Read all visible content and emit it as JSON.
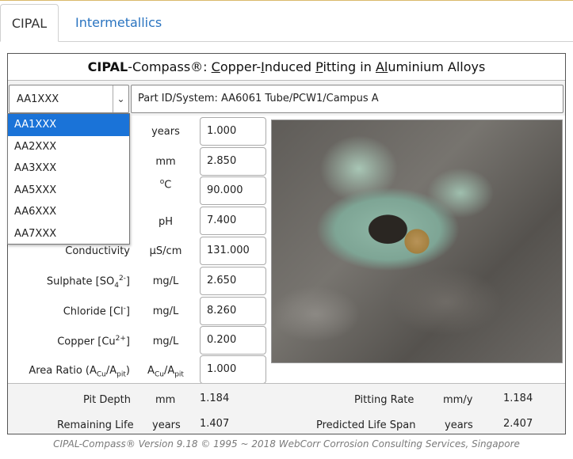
{
  "tabs": [
    {
      "label": "CIPAL",
      "active": true
    },
    {
      "label": "Intermetallics",
      "active": false
    }
  ],
  "title": {
    "brand": "CIPAL",
    "suffix": "-Compass®: ",
    "c1": "C",
    "r1": "opper-",
    "i1": "I",
    "r2": "nduced ",
    "p1": "P",
    "r3": "itting in ",
    "al": "Al",
    "r4": "uminium Alloys"
  },
  "alloy_select": {
    "value": "AA1XXX",
    "arrow": "⌄"
  },
  "part_id": "Part ID/System: AA6061 Tube/PCW1/Campus A",
  "dropdown_options": [
    "AA1XXX",
    "AA2XXX",
    "AA3XXX",
    "AA5XXX",
    "AA6XXX",
    "AA7XXX"
  ],
  "inputs": {
    "time": {
      "unit": "years",
      "value": "1.000"
    },
    "thickness": {
      "unit": "mm",
      "value": "2.850"
    },
    "temperature": {
      "unit_sup": "o",
      "unit": "C",
      "value": "90.000"
    },
    "ph": {
      "unit": "pH",
      "value": "7.400"
    },
    "conductivity": {
      "label": "Conductivity",
      "unit": "µS/cm",
      "value": "131.000"
    },
    "sulphate": {
      "label": "Sulphate [SO",
      "label_sub": "4",
      "label_sup": "2-",
      "label_end": "]",
      "unit": "mg/L",
      "value": "2.650"
    },
    "chloride": {
      "label": "Chloride [Cl",
      "label_sup": "-",
      "label_end": "]",
      "unit": "mg/L",
      "value": "8.260"
    },
    "copper": {
      "label": "Copper [Cu",
      "label_sup": "2+",
      "label_end": "]",
      "unit": "mg/L",
      "value": "0.200"
    },
    "area_ratio": {
      "label": "Area Ratio (A",
      "sub1": "Cu",
      "mid": "/A",
      "sub2": "pit",
      "end": ")",
      "unit_a1": "A",
      "unit_sub1": "Cu",
      "unit_mid": "/A",
      "unit_sub2": "pit",
      "value": "1.000"
    }
  },
  "results": {
    "pit_depth": {
      "label": "Pit Depth",
      "unit": "mm",
      "value": "1.184"
    },
    "pitting_rate": {
      "label": "Pitting Rate",
      "unit": "mm/y",
      "value": "1.184"
    },
    "remaining_life": {
      "label": "Remaining Life",
      "unit": "years",
      "value": "1.407"
    },
    "predicted_life": {
      "label": "Predicted Life Span",
      "unit": "years",
      "value": "2.407"
    }
  },
  "footer": "CIPAL-Compass®  Version 9.18  ©  1995 ~ 2018  WebCorr Corrosion Consulting Services, Singapore"
}
